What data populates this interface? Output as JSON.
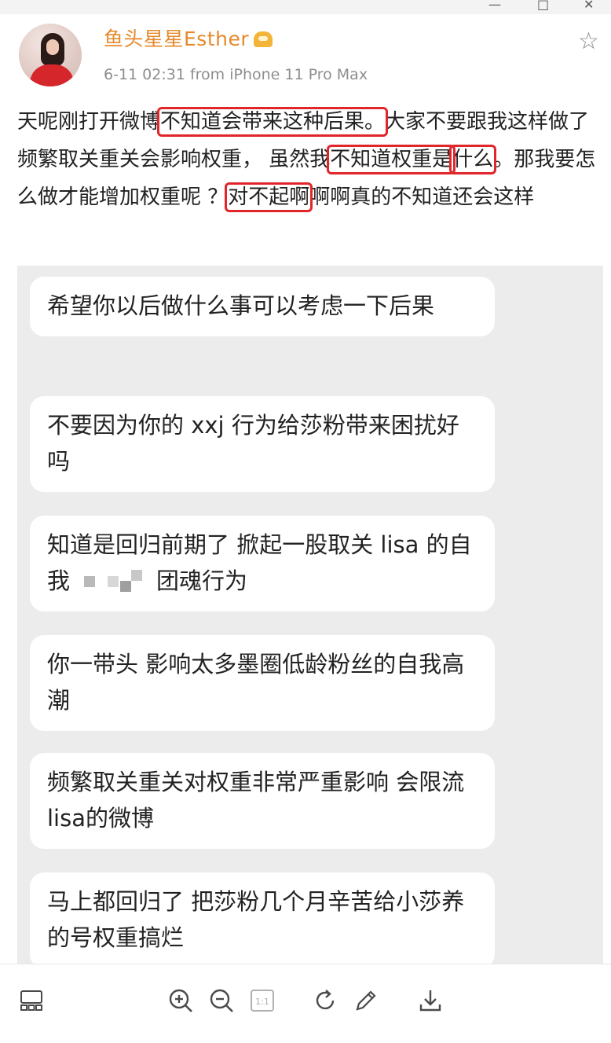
{
  "window": {
    "minimize_glyph": "—",
    "maximize_glyph": "□",
    "close_glyph": "✕"
  },
  "post": {
    "username": "鱼头星星Esther",
    "meta": "6-11 02:31  from iPhone 11 Pro Max",
    "text_parts": [
      "天呢刚打开微博",
      "不知道会带来这种后果。",
      "大家不要跟我这样做了 频繁取关重关会影响权重， 虽然我",
      "不知道权重是",
      "什么",
      "。那我要怎么做才能增加权重呢 ？",
      "对不起啊",
      "啊啊真的不知道还会这样"
    ]
  },
  "comments": [
    {
      "text": "希望你以后做什么事可以考虑一下后果"
    },
    {
      "text": "不要因为你的 xxj 行为给莎粉带来困扰好吗"
    },
    {
      "text_before": "知道是回归前期了 掀起一股取关 lisa 的自我",
      "text_after": "团魂行为"
    },
    {
      "text": "你一带头 影响太多墨圈低龄粉丝的自我高潮"
    },
    {
      "text": "频繁取关重关对权重非常严重影响 会限流lisa的微博"
    },
    {
      "text": "马上都回归了 把莎粉几个月辛苦给小莎养的号权重搞烂"
    }
  ],
  "toolbar": {
    "icons": [
      "gallery-icon",
      "zoom-in-icon",
      "zoom-out-icon",
      "actual-size-icon",
      "rotate-icon",
      "edit-icon",
      "download-icon"
    ],
    "actual_size_label": "1:1"
  },
  "colors": {
    "username": "#e58a2b",
    "highlight_box": "#e1262b",
    "comments_background": "#ececec"
  }
}
